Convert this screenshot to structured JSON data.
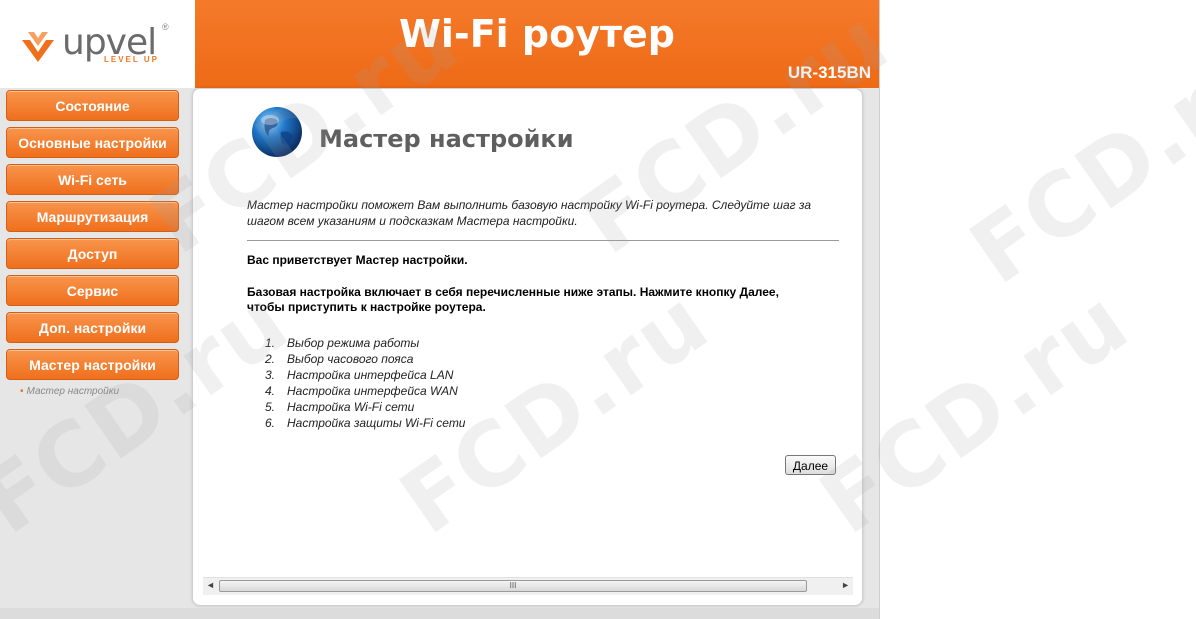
{
  "brand": {
    "logo_text": "upvel",
    "logo_reg": "®",
    "logo_tagline": "LEVEL UP"
  },
  "header": {
    "title": "Wi-Fi роутер",
    "model": "UR-315BN"
  },
  "sidebar": {
    "items": [
      {
        "label": "Состояние"
      },
      {
        "label": "Основные настройки"
      },
      {
        "label": "Wi-Fi сеть"
      },
      {
        "label": "Маршрутизация"
      },
      {
        "label": "Доступ"
      },
      {
        "label": "Сервис"
      },
      {
        "label": "Доп. настройки"
      },
      {
        "label": "Мастер настройки"
      }
    ],
    "sub_item": "Мастер настройки"
  },
  "main": {
    "title": "Мастер настройки",
    "intro": "Мастер настройки поможет Вам выполнить базовую настройку Wi-Fi роутера. Следуйте шаг за шагом всем указаниям и подсказкам Мастера настройки.",
    "welcome": "Вас приветствует Мастер настройки.",
    "description": "Базовая настройка включает в себя перечисленные ниже этапы. Нажмите кнопку Далее, чтобы приступить к настройке роутера.",
    "steps": [
      {
        "num": "1.",
        "label": "Выбор режима работы"
      },
      {
        "num": "2.",
        "label": "Выбор часового пояса"
      },
      {
        "num": "3.",
        "label": "Настройка интерфейса LAN"
      },
      {
        "num": "4.",
        "label": "Настройка интерфейса WAN"
      },
      {
        "num": "5.",
        "label": "Настройка Wi-Fi сети"
      },
      {
        "num": "6.",
        "label": "Настройка защиты Wi-Fi сети"
      }
    ],
    "next_button": "Далее"
  },
  "scrollbar": {
    "left_arrow": "◄",
    "right_arrow": "►",
    "grip": "III"
  },
  "watermark": "FCD.ru",
  "colors": {
    "accent": "#ef6f1c",
    "header": "#f47a2a",
    "frame": "#e6e6e6"
  }
}
